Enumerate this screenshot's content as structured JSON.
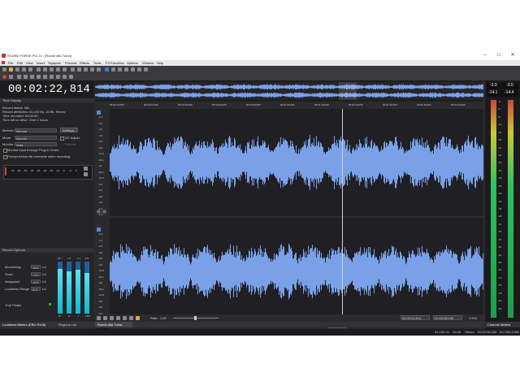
{
  "window": {
    "title": "SOUND FORGE Pro 14 - [Rondo alla Turca]",
    "minimize": "–",
    "maximize": "□",
    "close": "✕"
  },
  "menu": [
    "File",
    "Edit",
    "View",
    "Insert",
    "Signpost",
    "Process",
    "Effects",
    "Tools",
    "FX Favorites",
    "Options",
    "Window",
    "Help"
  ],
  "time_display": {
    "value": "00:02:22,814",
    "panel_title": "Time Display"
  },
  "record_info": {
    "lines": [
      "Record status:   Idle",
      "Record attributes: 44.100 Hz, 16 Bit, Stereo",
      "Time recorded:     00:00:00",
      "Time left on drive: Over 2 hours"
    ]
  },
  "record_form": {
    "method_label": "Method:",
    "method_value": "Normal",
    "settings_btn": "Settings...",
    "mode_label": "Mode:",
    "mode_value": "Normal",
    "dc_adjust": "DC Adjust",
    "monitor_label": "Monitor:",
    "monitor_value": "Auto",
    "calibrate": "Calibrate",
    "opt1": "Monitor input through Plug-in Chain",
    "opt2": "Prompt before file overwrite when recording",
    "scale": [
      "-Inf",
      "-60",
      "-50",
      "-40",
      "-30",
      "-20",
      "-15",
      "-10",
      "-6",
      "-3",
      "0"
    ]
  },
  "record_options": {
    "title": "Record Options"
  },
  "loudness": {
    "rows": [
      {
        "label": "Momentary",
        "value": "-8.3",
        "unit": "LU"
      },
      {
        "label": "Short",
        "value": "-7.1",
        "unit": "LU"
      },
      {
        "label": "Integrated",
        "value": "-6.9",
        "unit": "LU"
      },
      {
        "label": "Loudness Range",
        "value": "9.2",
        "unit": "LU"
      }
    ],
    "true_peaks": "True Peaks",
    "col_heads": [
      "-46.7",
      "-7.8",
      "-7.1",
      "-6.9"
    ],
    "col_foot": [
      "M",
      "S",
      "I",
      "LRA"
    ],
    "levels": [
      0.86,
      0.82,
      0.84,
      0.78
    ]
  },
  "bottom_tabs": {
    "loudness": "Loudness Meters (EBU R128)",
    "regions": "Regions List",
    "doc": "Rondo alla Turca"
  },
  "ruler_labels": [
    "00:00:10,000",
    "00:00:20,000",
    "00:00:30,000",
    "00:00:40,000",
    "00:00:50,000",
    "00:01:00,000",
    "00:01:10,000",
    "00:01:20,000",
    "00:01:30,000",
    "00:01:40,000",
    "00:01:50,000"
  ],
  "db_scale": [
    "-1.3",
    "-2.1",
    "-3.3",
    "-4.6",
    "-6.0",
    "-9.0",
    "-12.0",
    "-18.1",
    "-Inf",
    "-18.1",
    "-12.0",
    "-9.0",
    "-6.0",
    "-4.6",
    "-3.3",
    "-2.1",
    "-1.3"
  ],
  "transport": {
    "rate_label": "Rate:",
    "rate_value": "1,00",
    "pos1": "00:02:22,814",
    "pos2": "00:03:38,180",
    "zoom": "1:204"
  },
  "channel_meters": {
    "title": "Channel Meters",
    "peak_l": "-3.0",
    "peak_r": "-3.0",
    "rms_l": "-14.1",
    "rms_r": "-14.4",
    "scale": [
      "-3",
      "-6",
      "-9",
      "-12",
      "-15",
      "-18",
      "-21",
      "-24",
      "-27",
      "-30",
      "-33",
      "-36",
      "-39",
      "-42",
      "-45",
      "-48",
      "-51",
      "-54",
      "-57",
      "-60",
      "-63",
      "-66",
      "-69",
      "-72",
      "-75",
      "-78",
      "-81",
      "-84"
    ]
  },
  "status": {
    "rate": "44.100 Hz",
    "bits": "16 bit",
    "chan": "Stereo",
    "len": "00:03:38,180",
    "free": "142.355,3 MB"
  },
  "colors": {
    "waveform": "#7aa0e8",
    "background": "#2d2d30",
    "accent": "#c0392b"
  }
}
